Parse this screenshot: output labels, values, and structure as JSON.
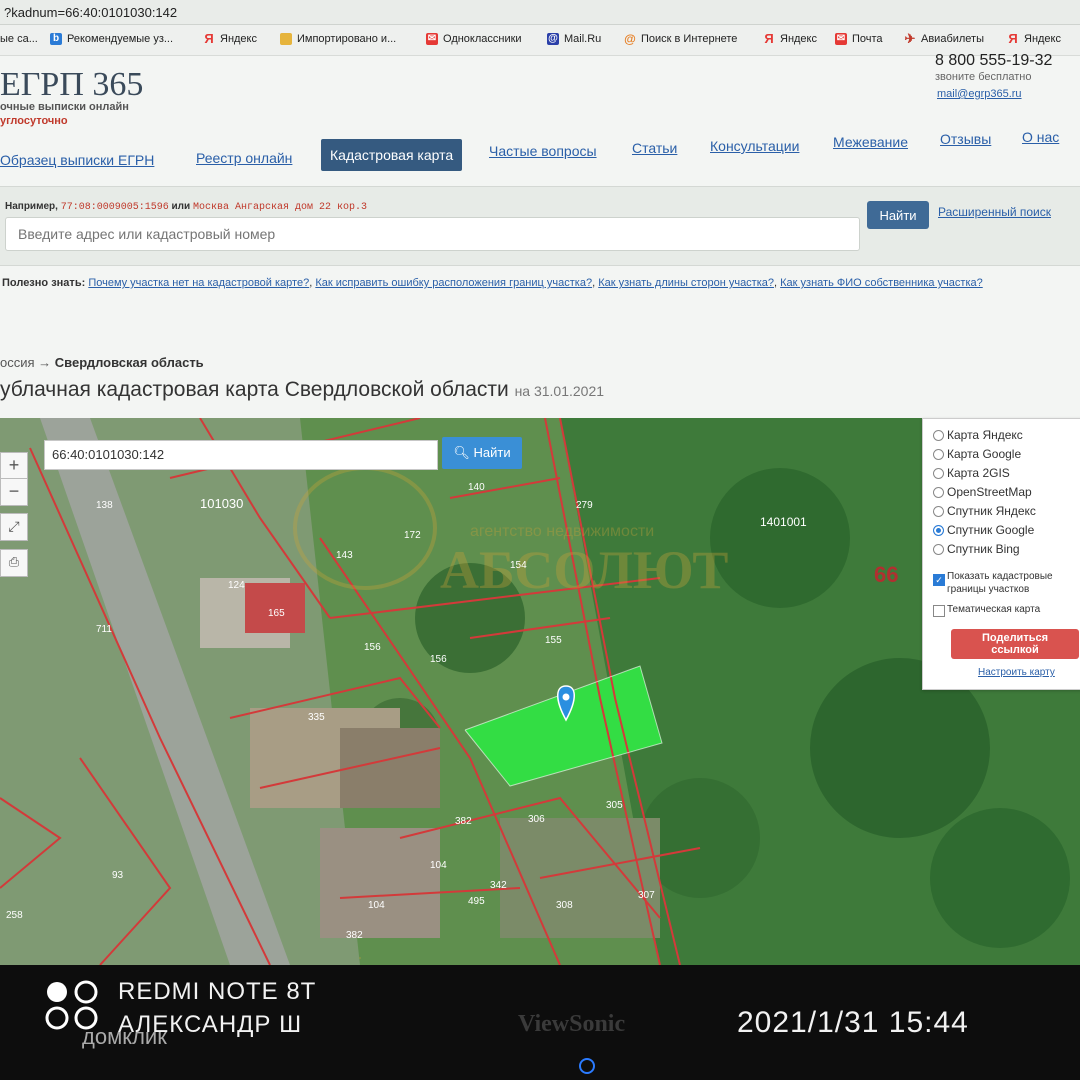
{
  "browser": {
    "url": "?kadnum=66:40:0101030:142",
    "bookmarks": [
      {
        "label": "ые са...",
        "icon": "site-icon",
        "color": "#888888"
      },
      {
        "label": "Рекомендуемые уз...",
        "icon": "bing-icon",
        "color": "#2a7bd6"
      },
      {
        "label": "Яндекс",
        "icon": "yandex-icon",
        "color": "#e53935"
      },
      {
        "label": "Импортировано и...",
        "icon": "folder-icon",
        "color": "#e6b43c"
      },
      {
        "label": "Одноклассники",
        "icon": "mail-icon",
        "color": "#e53935"
      },
      {
        "label": "Mail.Ru",
        "icon": "mailru-icon",
        "color": "#2a3fa8"
      },
      {
        "label": "Поиск в Интернете",
        "icon": "search-icon",
        "color": "#e67e22"
      },
      {
        "label": "Яндекс",
        "icon": "yandex-icon",
        "color": "#e53935"
      },
      {
        "label": "Почта",
        "icon": "mail-icon",
        "color": "#e53935"
      },
      {
        "label": "Авиабилеты",
        "icon": "plane-icon",
        "color": "#c0392b"
      },
      {
        "label": "Яндекс",
        "icon": "yandex-icon",
        "color": "#e53935"
      }
    ]
  },
  "header": {
    "logo": "ЕГРП 365",
    "tagline": "очные выписки онлайн",
    "tagline2": "углосуточно",
    "phone": "8 800 555-19-32",
    "phone_note": "звоните бесплатно",
    "email": "mail@egrp365.ru"
  },
  "nav": {
    "items": [
      "Образец выписки ЕГРН",
      "Реестр онлайн",
      "Кадастровая карта",
      "Частые вопросы",
      "Статьи",
      "Консультации",
      "Межевание",
      "Отзывы",
      "О нас"
    ],
    "active": "Кадастровая карта"
  },
  "search": {
    "example_prefix": "Например,",
    "example_code": "77:08:0009005:1596",
    "example_or": "или",
    "example_address": "Москва Ангарская дом 22 кор.3",
    "placeholder": "Введите адрес или кадастровый номер",
    "button": "Найти",
    "advanced": "Расширенный поиск"
  },
  "useful": {
    "label": "Полезно знать:",
    "links": [
      "Почему участка нет на кадастровой карте?",
      "Как исправить ошибку расположения границ участка?",
      "Как узнать длины сторон участка?",
      "Как узнать ФИО собственника участка?"
    ]
  },
  "breadcrumb": {
    "root": "оссия →",
    "current": "Свердловская область"
  },
  "page": {
    "title": "ублачная кадастровая карта Свердловской области",
    "date": "на 31.01.2021"
  },
  "map": {
    "search_value": "66:40:0101030:142",
    "find_button": "Найти",
    "zoom_in": "+",
    "zoom_out": "−",
    "region_number": "66",
    "watermark": "АБСОЛЮТ",
    "watermark_sub": "агентство недвижимости",
    "layers": [
      {
        "label": "Карта Яндекс",
        "selected": false
      },
      {
        "label": "Карта Google",
        "selected": false
      },
      {
        "label": "Карта 2GIS",
        "selected": false
      },
      {
        "label": "OpenStreetMap",
        "selected": false
      },
      {
        "label": "Спутник Яндекс",
        "selected": false
      },
      {
        "label": "Спутник Google",
        "selected": true
      },
      {
        "label": "Спутник Bing",
        "selected": false
      }
    ],
    "show_borders": "Показать кадастровые границы участков",
    "thematic": "Тематическая карта",
    "share_button": "Поделиться ссылкой",
    "setup_link": "Настроить карту",
    "parcel_labels": [
      "101030",
      "1401001",
      "140",
      "143",
      "124",
      "154",
      "155",
      "156",
      "156",
      "711",
      "335",
      "382",
      "306",
      "305",
      "104",
      "342",
      "495",
      "307",
      "308",
      "104",
      "382",
      "93",
      "279",
      "138",
      "172",
      "165",
      "258"
    ]
  },
  "overlay": {
    "device": "REDMI NOTE 8T",
    "author": "АЛЕКСАНДР Ш",
    "datetime": "2021/1/31 15:44",
    "monitor_brand": "ViewSonic",
    "domclick": "домклик"
  }
}
